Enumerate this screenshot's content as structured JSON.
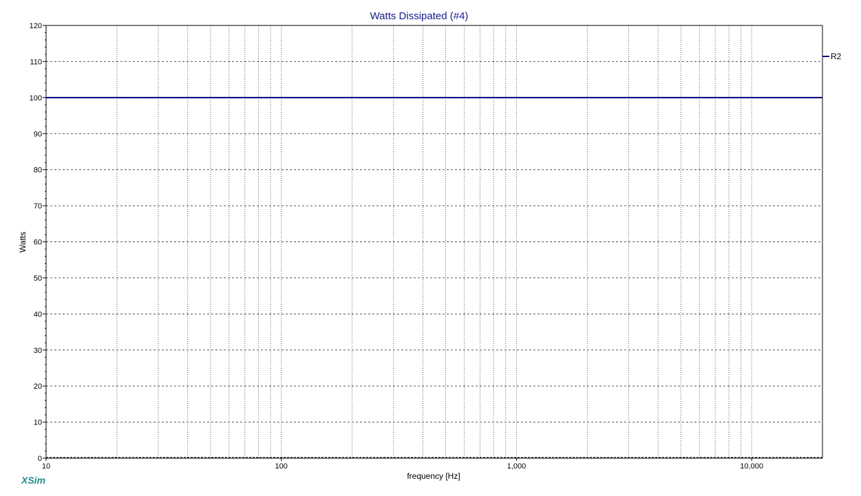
{
  "chart_data": {
    "type": "line",
    "title": "Watts Dissipated (#4)",
    "xlabel": "frequency [Hz]",
    "ylabel": "Watts",
    "xscale": "log",
    "xlim": [
      10,
      20000
    ],
    "ylim": [
      0,
      120
    ],
    "x_ticks": [
      {
        "value": 10,
        "label": "10"
      },
      {
        "value": 100,
        "label": "100"
      },
      {
        "value": 1000,
        "label": "1,000"
      },
      {
        "value": 10000,
        "label": "10,000"
      }
    ],
    "y_ticks": [
      {
        "value": 0,
        "label": "0"
      },
      {
        "value": 10,
        "label": "10"
      },
      {
        "value": 20,
        "label": "20"
      },
      {
        "value": 30,
        "label": "30"
      },
      {
        "value": 40,
        "label": "40"
      },
      {
        "value": 50,
        "label": "50"
      },
      {
        "value": 60,
        "label": "60"
      },
      {
        "value": 70,
        "label": "70"
      },
      {
        "value": 80,
        "label": "80"
      },
      {
        "value": 90,
        "label": "90"
      },
      {
        "value": 100,
        "label": "100"
      },
      {
        "value": 110,
        "label": "110"
      },
      {
        "value": 120,
        "label": "120"
      }
    ],
    "grid": true,
    "legend_position": "right",
    "series": [
      {
        "name": "R2",
        "color": "#00007f",
        "x": [
          10,
          20000
        ],
        "y": [
          100,
          100
        ]
      }
    ]
  },
  "colors": {
    "title": "#1a1a8c",
    "series": "#00007f",
    "grid": "#555555",
    "brand": "#1f8a8a"
  },
  "brand": {
    "label": "XSim"
  }
}
